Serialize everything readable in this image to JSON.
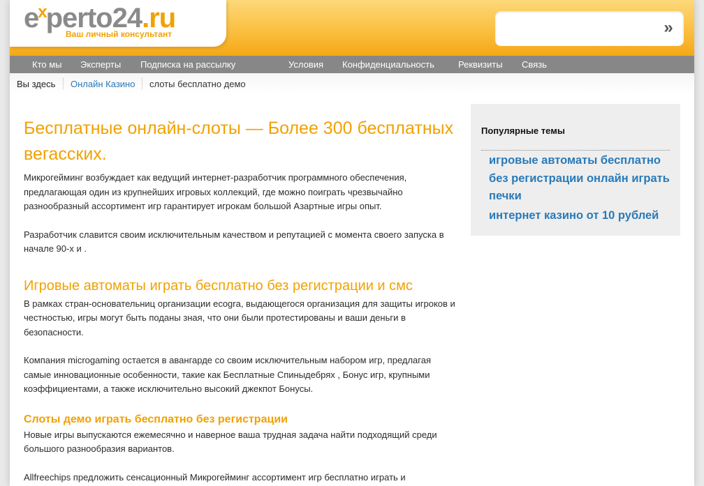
{
  "logo": {
    "e": "e",
    "x": "x",
    "perto": "perto24",
    "ru": ".ru",
    "tagline": "Ваш личный консультант"
  },
  "search": {
    "value": "",
    "go_glyph": "»"
  },
  "nav": [
    "Кто мы",
    "Эксперты",
    "Подписка на рассылку",
    "Условия",
    "Конфиденциальность",
    "Реквизиты",
    "Связь"
  ],
  "breadcrumb": {
    "here": "Вы здесь",
    "link": "Онлайн Казино",
    "current": "слоты бесплатно демо"
  },
  "article": {
    "title": "Бесплатные онлайн-слоты — Более 300 бесплатных вегасских.",
    "p1": "Микрогейминг возбуждает как ведущий интернет-разработчик программного обеспечения, предлагающая один из крупнейших игровых коллекций, где можно поиграть чрезвычайно разнообразный ассортимент игр гарантирует игрокам большой Азартные игры опыт.",
    "p2": "Разработчик славится своим исключительным качеством и репутацией с момента своего запуска в начале 90-х и .",
    "h2": "Игровые автоматы играть бесплатно без регистрации и смс",
    "p3": "В рамках стран-основательниц организации ecogra, выдающегося организация для защиты игроков и честностью, игры могут быть поданы зная, что они были протестированы и ваши деньги в безопасности.",
    "p4": "Компания microgaming остается в авангарде со своим исключительным набором игр, предлагая самые инновационные особенности, такие как Бесплатные Спиныдебрях , Бонус игр, крупными коэффициентами, а также исключительно высокий джекпот Бонусы.",
    "h3": "Слоты демо играть бесплатно без регистрации",
    "p5": "Новые игры выпускаются ежемесячно и наверное ваша трудная задача найти подходящий среди большого разнообразия вариантов.",
    "p6": "Allfreechips предложить сенсационный Микрогейминг ассортимент игр бесплатно играть и"
  },
  "sidebar": {
    "title": "Популярные темы",
    "links": [
      "игровые автоматы бесплатно без регистрации онлайн играть печки",
      "интернет казино от 10 рублей"
    ]
  }
}
